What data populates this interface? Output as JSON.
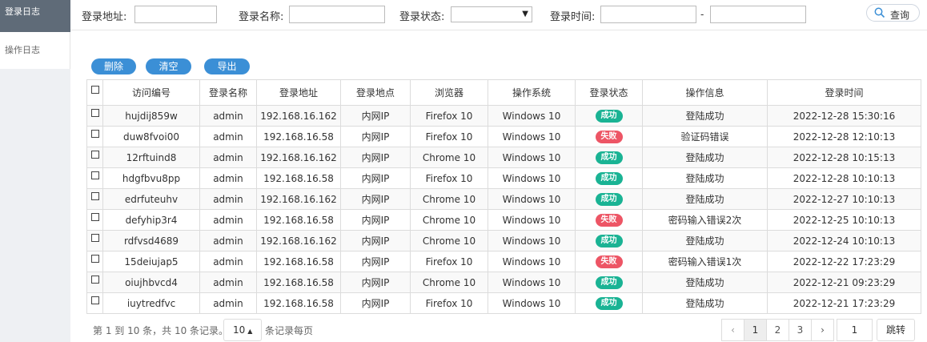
{
  "sidebar": {
    "items": [
      {
        "label": "登录日志"
      },
      {
        "label": "操作日志"
      }
    ]
  },
  "search": {
    "address_label": "登录地址:",
    "name_label": "登录名称:",
    "status_label": "登录状态:",
    "status_value": "",
    "time_label": "登录时间:",
    "time_sep": "-",
    "query_label": "查询"
  },
  "toolbar": {
    "delete_label": "删除",
    "clear_label": "清空",
    "export_label": "导出"
  },
  "table": {
    "headers": [
      "访问编号",
      "登录名称",
      "登录地址",
      "登录地点",
      "浏览器",
      "操作系统",
      "登录状态",
      "操作信息",
      "登录时间"
    ],
    "rows": [
      {
        "id": "hujdij859w",
        "name": "admin",
        "addr": "192.168.16.162",
        "loc": "内网IP",
        "browser": "Firefox 10",
        "os": "Windows 10",
        "status": "成功",
        "status_type": "ok",
        "msg": "登陆成功",
        "time": "2022-12-28 15:30:16"
      },
      {
        "id": "duw8fvoi00",
        "name": "admin",
        "addr": "192.168.16.58",
        "loc": "内网IP",
        "browser": "Firefox 10",
        "os": "Windows 10",
        "status": "失败",
        "status_type": "fail",
        "msg": "验证码错误",
        "time": "2022-12-28 12:10:13"
      },
      {
        "id": "12rftuind8",
        "name": "admin",
        "addr": "192.168.16.162",
        "loc": "内网IP",
        "browser": "Chrome 10",
        "os": "Windows 10",
        "status": "成功",
        "status_type": "ok",
        "msg": "登陆成功",
        "time": "2022-12-28 10:15:13"
      },
      {
        "id": "hdgfbvu8pp",
        "name": "admin",
        "addr": "192.168.16.58",
        "loc": "内网IP",
        "browser": "Firefox 10",
        "os": "Windows 10",
        "status": "成功",
        "status_type": "ok",
        "msg": "登陆成功",
        "time": "2022-12-28 10:10:13"
      },
      {
        "id": "edrfuteuhv",
        "name": "admin",
        "addr": "192.168.16.162",
        "loc": "内网IP",
        "browser": "Chrome 10",
        "os": "Windows 10",
        "status": "成功",
        "status_type": "ok",
        "msg": "登陆成功",
        "time": "2022-12-27 10:10:13"
      },
      {
        "id": "defyhip3r4",
        "name": "admin",
        "addr": "192.168.16.58",
        "loc": "内网IP",
        "browser": "Chrome 10",
        "os": "Windows 10",
        "status": "失败",
        "status_type": "fail",
        "msg": "密码输入错误2次",
        "time": "2022-12-25 10:10:13"
      },
      {
        "id": "rdfvsd4689",
        "name": "admin",
        "addr": "192.168.16.162",
        "loc": "内网IP",
        "browser": "Chrome 10",
        "os": "Windows 10",
        "status": "成功",
        "status_type": "ok",
        "msg": "登陆成功",
        "time": "2022-12-24 10:10:13"
      },
      {
        "id": "15deiujap5",
        "name": "admin",
        "addr": "192.168.16.58",
        "loc": "内网IP",
        "browser": "Firefox 10",
        "os": "Windows 10",
        "status": "失败",
        "status_type": "fail",
        "msg": "密码输入错误1次",
        "time": "2022-12-22 17:23:29"
      },
      {
        "id": "oiujhbvcd4",
        "name": "admin",
        "addr": "192.168.16.58",
        "loc": "内网IP",
        "browser": "Chrome 10",
        "os": "Windows 10",
        "status": "成功",
        "status_type": "ok",
        "msg": "登陆成功",
        "time": "2022-12-21 09:23:29"
      },
      {
        "id": "iuytredfvc",
        "name": "admin",
        "addr": "192.168.16.58",
        "loc": "内网IP",
        "browser": "Firefox 10",
        "os": "Windows 10",
        "status": "成功",
        "status_type": "ok",
        "msg": "登陆成功",
        "time": "2022-12-21 17:23:29"
      }
    ]
  },
  "footer": {
    "info": "第 1 到 10 条，共 10 条记录。",
    "page_size": "10",
    "per_page_label": "条记录每页",
    "pages": [
      "1",
      "2",
      "3"
    ],
    "prev": "‹",
    "next": "›",
    "jump_value": "1",
    "jump_label": "跳转"
  },
  "colors": {
    "sidebar_active": "#5f6b78",
    "button_blue": "#3b8fd6",
    "success": "#1ab394",
    "fail": "#ed5565"
  }
}
